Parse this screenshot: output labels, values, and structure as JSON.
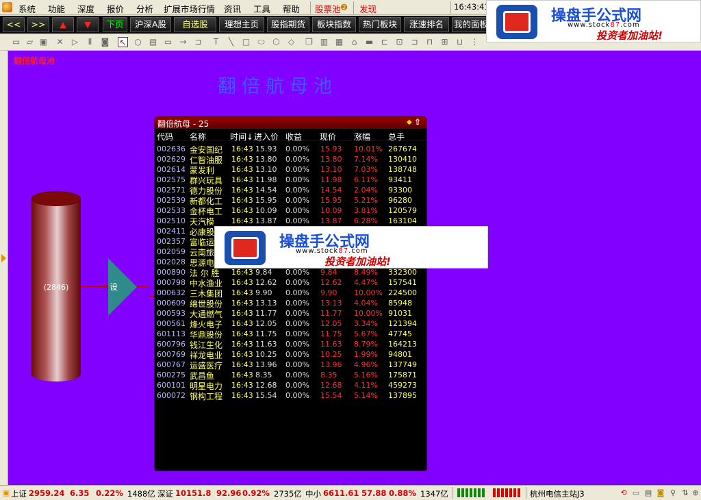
{
  "menubar": {
    "items": [
      "系统",
      "功能",
      "深度",
      "报价",
      "分析",
      "扩展市场行情",
      "资讯",
      "工具",
      "帮助"
    ],
    "pool_label": "股票池",
    "pool_badge": "❷",
    "discover_label": "发现",
    "clock": "16:43:41"
  },
  "toolbar": {
    "prev": "<<",
    "next": ">>",
    "up": "▲",
    "down": "▼",
    "next_page": "下页",
    "tabs": [
      "沪深A股",
      "自选股",
      "理想主页",
      "股指期货",
      "板块指数",
      "热门板块",
      "涨速排名",
      "我的面板"
    ]
  },
  "canvas": {
    "corner_label": "翻倍航母池",
    "title": "翻倍航母池",
    "bg_color": "#8200ff"
  },
  "cylinder": {
    "label": "(2846)"
  },
  "triangle": {
    "label": "设"
  },
  "panel": {
    "title": "翻倍航母 - 25",
    "columns": [
      "代码",
      "名称",
      "时间↓",
      "进入价",
      "收益",
      "现价",
      "涨幅",
      "总手"
    ],
    "rows": [
      {
        "code": "002636",
        "name": "金安国纪",
        "time": "16:43",
        "entry": "15.93",
        "gain": "0.00%",
        "price": "15.93",
        "change": "10.01%",
        "volume": "267674"
      },
      {
        "code": "002629",
        "name": "仁智油服",
        "time": "16:43",
        "entry": "13.80",
        "gain": "0.00%",
        "price": "13.80",
        "change": "7.14%",
        "volume": "130410"
      },
      {
        "code": "002614",
        "name": "蒙发利",
        "time": "16:43",
        "entry": "13.10",
        "gain": "0.00%",
        "price": "13.10",
        "change": "7.03%",
        "volume": "138748"
      },
      {
        "code": "002575",
        "name": "群兴玩具",
        "time": "16:43",
        "entry": "11.98",
        "gain": "0.00%",
        "price": "11.98",
        "change": "6.11%",
        "volume": "93411"
      },
      {
        "code": "002571",
        "name": "德力股份",
        "time": "16:43",
        "entry": "14.54",
        "gain": "0.00%",
        "price": "14.54",
        "change": "2.04%",
        "volume": "93300"
      },
      {
        "code": "002539",
        "name": "新都化工",
        "time": "16:43",
        "entry": "15.95",
        "gain": "0.00%",
        "price": "15.95",
        "change": "5.21%",
        "volume": "96280"
      },
      {
        "code": "002533",
        "name": "金杯电工",
        "time": "16:43",
        "entry": "10.09",
        "gain": "0.00%",
        "price": "10.09",
        "change": "3.81%",
        "volume": "120579"
      },
      {
        "code": "002510",
        "name": "天汽模",
        "time": "16:43",
        "entry": "13.87",
        "gain": "0.00%",
        "price": "13.87",
        "change": "6.28%",
        "volume": "163104"
      },
      {
        "code": "002411",
        "name": "必康股",
        "time": "",
        "entry": "",
        "gain": "",
        "price": "",
        "change": "",
        "volume": ""
      },
      {
        "code": "002357",
        "name": "富临运",
        "time": "",
        "entry": "",
        "gain": "",
        "price": "",
        "change": "",
        "volume": ""
      },
      {
        "code": "002059",
        "name": "云南旅",
        "time": "",
        "entry": "",
        "gain": "",
        "price": "",
        "change": "",
        "volume": ""
      },
      {
        "code": "002028",
        "name": "思源电",
        "time": "",
        "entry": "",
        "gain": "",
        "price": "",
        "change": "",
        "volume": ""
      },
      {
        "code": "000890",
        "name": "法 尔 胜",
        "time": "16:43",
        "entry": "9.84",
        "gain": "0.00%",
        "price": "9.84",
        "change": "8.49%",
        "volume": "332300"
      },
      {
        "code": "000798",
        "name": "中水渔业",
        "time": "16:43",
        "entry": "12.62",
        "gain": "0.00%",
        "price": "12.62",
        "change": "4.47%",
        "volume": "157541"
      },
      {
        "code": "000632",
        "name": "三木集团",
        "time": "16:43",
        "entry": "9.90",
        "gain": "0.00%",
        "price": "9.90",
        "change": "10.00%",
        "volume": "224500"
      },
      {
        "code": "000609",
        "name": "绵世股份",
        "time": "16:43",
        "entry": "13.13",
        "gain": "0.00%",
        "price": "13.13",
        "change": "4.04%",
        "volume": "85948"
      },
      {
        "code": "000593",
        "name": "大通燃气",
        "time": "16:43",
        "entry": "11.77",
        "gain": "0.00%",
        "price": "11.77",
        "change": "10.00%",
        "volume": "91031"
      },
      {
        "code": "000561",
        "name": "烽火电子",
        "time": "16:43",
        "entry": "12.05",
        "gain": "0.00%",
        "price": "12.05",
        "change": "3.34%",
        "volume": "121394"
      },
      {
        "code": "601113",
        "name": "华鼎股份",
        "time": "16:43",
        "entry": "11.75",
        "gain": "0.00%",
        "price": "11.75",
        "change": "5.67%",
        "volume": "47745"
      },
      {
        "code": "600796",
        "name": "钱江生化",
        "time": "16:43",
        "entry": "11.63",
        "gain": "0.00%",
        "price": "11.63",
        "change": "8.79%",
        "volume": "164213"
      },
      {
        "code": "600769",
        "name": "祥龙电业",
        "time": "16:43",
        "entry": "10.25",
        "gain": "0.00%",
        "price": "10.25",
        "change": "1.99%",
        "volume": "94801"
      },
      {
        "code": "600767",
        "name": "运盛医疗",
        "time": "16:43",
        "entry": "13.96",
        "gain": "0.00%",
        "price": "13.96",
        "change": "4.96%",
        "volume": "137749"
      },
      {
        "code": "600275",
        "name": "武昌鱼",
        "time": "16:43",
        "entry": "8.35",
        "gain": "0.00%",
        "price": "8.35",
        "change": "5.16%",
        "volume": "175871"
      },
      {
        "code": "600101",
        "name": "明星电力",
        "time": "16:43",
        "entry": "12.68",
        "gain": "0.00%",
        "price": "12.68",
        "change": "4.11%",
        "volume": "459273"
      },
      {
        "code": "600072",
        "name": "钢构工程",
        "time": "16:43",
        "entry": "15.54",
        "gain": "0.00%",
        "price": "15.54",
        "change": "5.14%",
        "volume": "137895"
      }
    ]
  },
  "watermark": {
    "brand": "操盘手公式网",
    "site_prefix": "www.stock",
    "site_num": "87",
    "site_suffix": ".com",
    "slogan": "投资者加油站!"
  },
  "status": {
    "sh_label": "上证",
    "sh_index": "2959.24",
    "sh_change": "6.35",
    "sh_pct": "0.22%",
    "sh_amount": "1488亿",
    "sz_label": "深证",
    "sz_index": "10151.8",
    "sz_change": "92.96",
    "sz_pct": "0.92%",
    "sz_amount": "2735亿",
    "sme_label": "中小",
    "sme_index": "6611.61",
    "sme_change": "57.88",
    "sme_pct": "0.88%",
    "sme_amount": "1347亿",
    "server": "杭州电信主站J3"
  }
}
